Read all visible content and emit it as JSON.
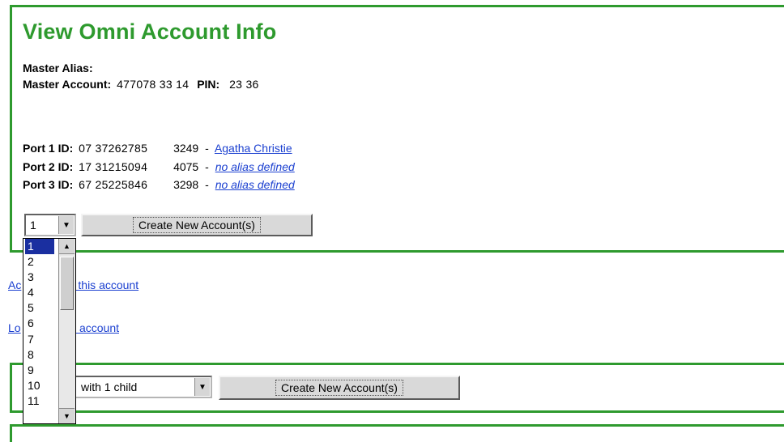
{
  "title": "View Omni Account Info",
  "master": {
    "alias_label": "Master Alias:",
    "alias_value": "",
    "account_label": "Master Account:",
    "account_value": "477078  33  14",
    "pin_label": "PIN:",
    "pin_value": "23  36"
  },
  "ports": [
    {
      "label": "Port 1 ID:",
      "id": "07  37262785",
      "code": "3249",
      "alias": "Agatha Christie",
      "alias_italic": false
    },
    {
      "label": "Port 2 ID:",
      "id": "17  31215094",
      "code": "4075",
      "alias": "no alias defined",
      "alias_italic": true
    },
    {
      "label": "Port 3 ID:",
      "id": "67  25225846",
      "code": "3298",
      "alias": "no alias defined",
      "alias_italic": true
    }
  ],
  "count_select": {
    "value": "1"
  },
  "create_button_label": "Create New Account(s)",
  "dropdown": {
    "options": [
      "1",
      "2",
      "3",
      "4",
      "5",
      "6",
      "7",
      "8",
      "9",
      "10",
      "11"
    ],
    "selected_index": 0,
    "up_arrow": "▲",
    "down_arrow": "▼"
  },
  "links": {
    "add": {
      "visible_start": "Ac",
      "visible_end": "s to this account"
    },
    "remove": {
      "visible_start": "Lo",
      "visible_end": "this account"
    }
  },
  "mid_panel": {
    "select_value": "with 1 child",
    "create_button_label": "Create New Account(s)"
  },
  "colors": {
    "accent_green": "#2e9a2e",
    "link_blue": "#1a3fd0"
  }
}
